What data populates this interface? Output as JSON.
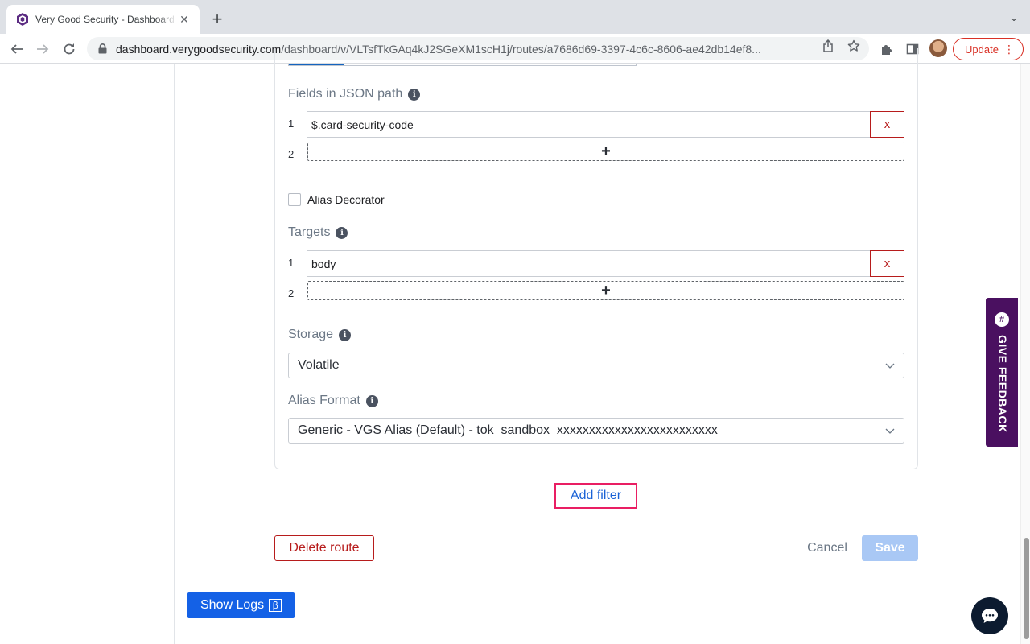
{
  "browser": {
    "tab_title": "Very Good Security - Dashboard",
    "tab_close": "✕",
    "new_tab": "+",
    "tab_menu": "⌄",
    "url_host": "dashboard.verygoodsecurity.com",
    "url_path": "/dashboard/v/VLTsfTkGAq4kJ2SGeXM1scH1j/routes/a7686d69-3397-4c6c-8606-ae42db14ef8...",
    "update_label": "Update"
  },
  "form": {
    "fields_label": "Fields in JSON path",
    "fields": [
      {
        "index": "1",
        "value": "$.card-security-code",
        "remove_label": "x"
      }
    ],
    "fields_add_index": "2",
    "add_glyph": "+",
    "alias_decorator_label": "Alias Decorator",
    "targets_label": "Targets",
    "targets": [
      {
        "index": "1",
        "value": "body",
        "remove_label": "x"
      }
    ],
    "targets_add_index": "2",
    "storage_label": "Storage",
    "storage_value": "Volatile",
    "alias_format_label": "Alias Format",
    "alias_format_value": "Generic - VGS Alias (Default) - tok_sandbox_xxxxxxxxxxxxxxxxxxxxxxxxx",
    "info_glyph": "i"
  },
  "actions": {
    "add_filter": "Add filter",
    "delete_route": "Delete route",
    "cancel": "Cancel",
    "save": "Save"
  },
  "show_logs": {
    "label": "Show Logs",
    "badge": "β"
  },
  "feedback": {
    "label": "GIVE FEEDBACK",
    "glyph": "#"
  },
  "colors": {
    "accent": "#1461e6",
    "danger": "#b71c1c",
    "highlight": "#e91e63",
    "feedback_bg": "#4a1060"
  }
}
